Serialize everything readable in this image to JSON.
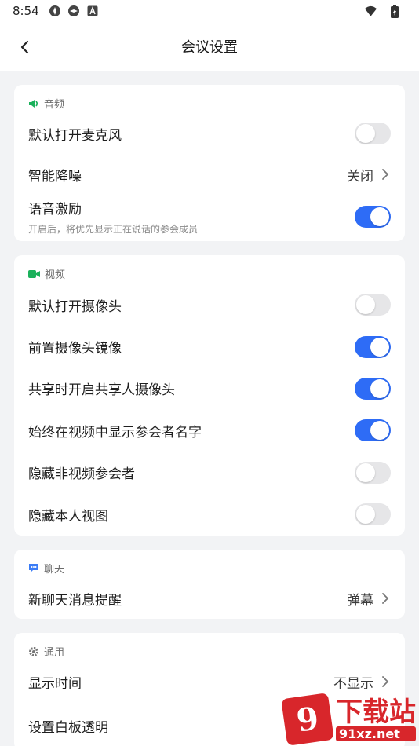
{
  "status_bar": {
    "time": "8:54"
  },
  "header": {
    "title": "会议设置"
  },
  "audio": {
    "title": "音频",
    "items": [
      {
        "label": "默认打开麦克风",
        "toggle": false
      },
      {
        "label": "智能降噪",
        "value": "关闭"
      },
      {
        "label": "语音激励",
        "sub": "开启后，将优先显示正在说话的参会成员",
        "toggle": true
      }
    ]
  },
  "video": {
    "title": "视频",
    "items": [
      {
        "label": "默认打开摄像头",
        "toggle": false
      },
      {
        "label": "前置摄像头镜像",
        "toggle": true
      },
      {
        "label": "共享时开启共享人摄像头",
        "toggle": true
      },
      {
        "label": "始终在视频中显示参会者名字",
        "toggle": true
      },
      {
        "label": "隐藏非视频参会者",
        "toggle": false
      },
      {
        "label": "隐藏本人视图",
        "toggle": false
      }
    ]
  },
  "chat": {
    "title": "聊天",
    "items": [
      {
        "label": "新聊天消息提醒",
        "value": "弹幕"
      }
    ]
  },
  "general": {
    "title": "通用",
    "items": [
      {
        "label": "显示时间",
        "value": "不显示"
      },
      {
        "label": "设置白板透明"
      }
    ]
  },
  "watermark": {
    "badge": "9",
    "text": "下载站",
    "url": "91xz.net"
  },
  "colors": {
    "accent": "#2e6cf6",
    "section_icon_green": "#1bb15b",
    "chat_icon_blue": "#3b7cf6"
  }
}
